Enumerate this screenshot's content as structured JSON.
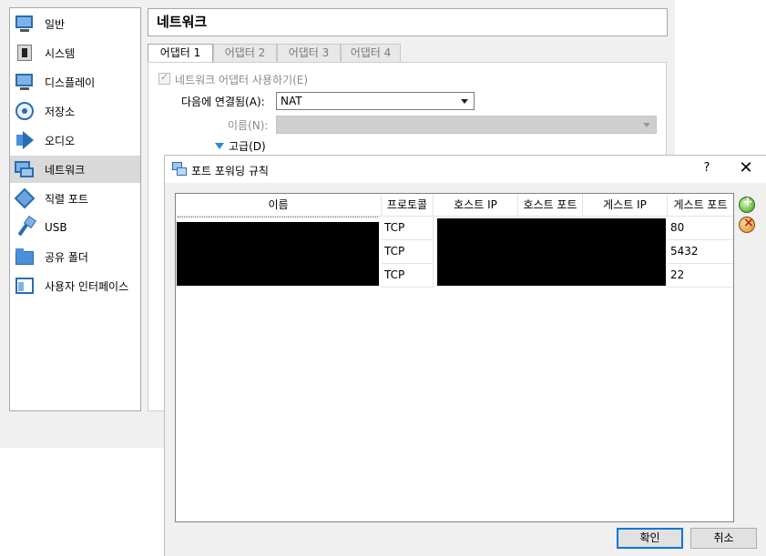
{
  "settings": {
    "sidebar": {
      "items": [
        {
          "label": "일반",
          "icon": "monitor-icon",
          "selected": false
        },
        {
          "label": "시스템",
          "icon": "chip-icon",
          "selected": false
        },
        {
          "label": "디스플레이",
          "icon": "monitor-icon",
          "selected": false
        },
        {
          "label": "저장소",
          "icon": "disk-icon",
          "selected": false
        },
        {
          "label": "오디오",
          "icon": "speaker-icon",
          "selected": false
        },
        {
          "label": "네트워크",
          "icon": "network-icon",
          "selected": true
        },
        {
          "label": "직렬 포트",
          "icon": "serial-port-icon",
          "selected": false
        },
        {
          "label": "USB",
          "icon": "usb-icon",
          "selected": false
        },
        {
          "label": "공유 폴더",
          "icon": "folder-icon",
          "selected": false
        },
        {
          "label": "사용자 인터페이스",
          "icon": "user-interface-icon",
          "selected": false
        }
      ]
    },
    "section_title": "네트워크",
    "tabs": [
      "어댑터 1",
      "어댑터 2",
      "어댑터 3",
      "어댑터 4"
    ],
    "active_tab": 0,
    "enable_adapter_label": "네트워크 어댑터 사용하기(E)",
    "attached_to_label": "다음에 연결됨(A):",
    "attached_to_value": "NAT",
    "name_label": "이름(N):",
    "name_value": "",
    "advanced_label": "고급(D)"
  },
  "dialog": {
    "title": "포트 포워딩 규칙",
    "help_label": "?",
    "close_label": "✕",
    "columns": [
      "이름",
      "프로토콜",
      "호스트 IP",
      "호스트 포트",
      "게스트 IP",
      "게스트 포트"
    ],
    "rows": [
      {
        "protocol": "TCP",
        "guest_port": "80"
      },
      {
        "protocol": "TCP",
        "guest_port": "5432"
      },
      {
        "protocol": "TCP",
        "guest_port": "22"
      }
    ],
    "ok_label": "확인",
    "cancel_label": "취소"
  },
  "colors": {
    "accent": "#0078d7",
    "selection": "#d9d9d9",
    "icon_blue": "#2a6cb0",
    "add_green": "#3a9a1a",
    "remove_orange": "#d8871a"
  }
}
